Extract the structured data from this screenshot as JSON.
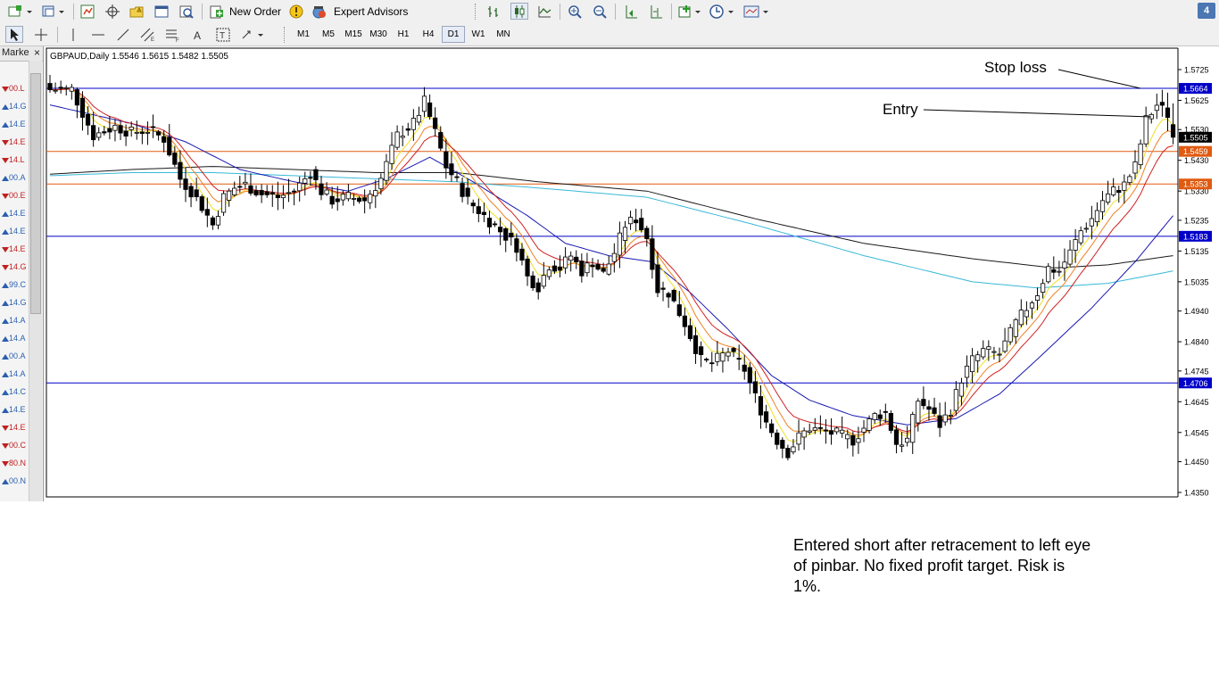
{
  "toolbar": {
    "new_order_label": "New Order",
    "expert_advisors_label": "Expert Advisors",
    "badge": "4"
  },
  "timeframes": [
    {
      "label": "M1",
      "active": false
    },
    {
      "label": "M5",
      "active": false
    },
    {
      "label": "M15",
      "active": false
    },
    {
      "label": "M30",
      "active": false
    },
    {
      "label": "H1",
      "active": false
    },
    {
      "label": "H4",
      "active": false
    },
    {
      "label": "D1",
      "active": true
    },
    {
      "label": "W1",
      "active": false
    },
    {
      "label": "MN",
      "active": false
    }
  ],
  "market_watch": {
    "title": "Marke",
    "rows": [
      {
        "text": "00.L",
        "color": "#c02020"
      },
      {
        "text": "14.G",
        "color": "#2a5fb0"
      },
      {
        "text": "14.E",
        "color": "#2a5fb0"
      },
      {
        "text": "14.E",
        "color": "#c02020"
      },
      {
        "text": "14.L",
        "color": "#c02020"
      },
      {
        "text": "00.A",
        "color": "#2a5fb0"
      },
      {
        "text": "00.E",
        "color": "#c02020"
      },
      {
        "text": "14.E",
        "color": "#2a5fb0"
      },
      {
        "text": "14.E",
        "color": "#2a5fb0"
      },
      {
        "text": "14.E",
        "color": "#c02020"
      },
      {
        "text": "14.G",
        "color": "#c02020"
      },
      {
        "text": "99.C",
        "color": "#2a5fb0"
      },
      {
        "text": "14.G",
        "color": "#2a5fb0"
      },
      {
        "text": "14.A",
        "color": "#2a5fb0"
      },
      {
        "text": "14.A",
        "color": "#2a5fb0"
      },
      {
        "text": "00.A",
        "color": "#2a5fb0"
      },
      {
        "text": "14.A",
        "color": "#2a5fb0"
      },
      {
        "text": "14.C",
        "color": "#2a5fb0"
      },
      {
        "text": "14.E",
        "color": "#2a5fb0"
      },
      {
        "text": "14.E",
        "color": "#c02020"
      },
      {
        "text": "00.C",
        "color": "#c02020"
      },
      {
        "text": "80.N",
        "color": "#c02020"
      },
      {
        "text": "00.N",
        "color": "#2a5fb0"
      }
    ]
  },
  "chart_data": {
    "type": "candlestick",
    "symbol_header": "GBPAUD,Daily  1.5546 1.5615 1.5482 1.5505",
    "ylim": [
      1.434,
      1.578
    ],
    "y_ticks": [
      1.5725,
      1.5625,
      1.553,
      1.543,
      1.533,
      1.5235,
      1.5135,
      1.5035,
      1.494,
      1.484,
      1.4745,
      1.4645,
      1.4545,
      1.445,
      1.435
    ],
    "y_tick_labels": [
      "1.5725",
      "1.5625",
      "1.5530",
      "1.5430",
      "1.5330",
      "1.5235",
      "1.5135",
      "1.5035",
      "1.4940",
      "1.4840",
      "1.4745",
      "1.4645",
      "1.4545",
      "1.4450",
      "1.4350"
    ],
    "horizontal_lines": [
      {
        "value": 1.5664,
        "label": "1.5664",
        "color": "#0000c8"
      },
      {
        "value": 1.5459,
        "label": "1.5459",
        "color": "#e05a10"
      },
      {
        "value": 1.5353,
        "label": "1.5353",
        "color": "#e05a10"
      },
      {
        "value": 1.5183,
        "label": "1.5183",
        "color": "#0000c8"
      },
      {
        "value": 1.4706,
        "label": "1.4706",
        "color": "#0000c8"
      }
    ],
    "current_price": {
      "value": 1.5505,
      "label": "1.5505"
    },
    "anchors": [
      [
        0,
        1.566
      ],
      [
        4,
        1.566
      ],
      [
        8,
        1.551
      ],
      [
        12,
        1.554
      ],
      [
        15,
        1.552
      ],
      [
        18,
        1.553
      ],
      [
        21,
        1.55
      ],
      [
        24,
        1.537
      ],
      [
        26,
        1.533
      ],
      [
        28,
        1.528
      ],
      [
        30,
        1.522
      ],
      [
        32,
        1.531
      ],
      [
        34,
        1.534
      ],
      [
        36,
        1.535
      ],
      [
        39,
        1.532
      ],
      [
        42,
        1.531
      ],
      [
        45,
        1.533
      ],
      [
        48,
        1.539
      ],
      [
        50,
        1.533
      ],
      [
        52,
        1.53
      ],
      [
        55,
        1.531
      ],
      [
        58,
        1.53
      ],
      [
        61,
        1.537
      ],
      [
        64,
        1.551
      ],
      [
        67,
        1.555
      ],
      [
        69,
        1.562
      ],
      [
        71,
        1.552
      ],
      [
        73,
        1.541
      ],
      [
        75,
        1.536
      ],
      [
        77,
        1.53
      ],
      [
        80,
        1.525
      ],
      [
        83,
        1.52
      ],
      [
        86,
        1.515
      ],
      [
        88,
        1.505
      ],
      [
        90,
        1.502
      ],
      [
        92,
        1.509
      ],
      [
        94,
        1.508
      ],
      [
        96,
        1.512
      ],
      [
        98,
        1.507
      ],
      [
        100,
        1.51
      ],
      [
        102,
        1.506
      ],
      [
        104,
        1.513
      ],
      [
        106,
        1.522
      ],
      [
        108,
        1.524
      ],
      [
        110,
        1.518
      ],
      [
        112,
        1.501
      ],
      [
        114,
        1.5
      ],
      [
        117,
        1.49
      ],
      [
        120,
        1.478
      ],
      [
        122,
        1.477
      ],
      [
        125,
        1.481
      ],
      [
        128,
        1.475
      ],
      [
        130,
        1.466
      ],
      [
        132,
        1.458
      ],
      [
        134,
        1.452
      ],
      [
        136,
        1.448
      ],
      [
        138,
        1.453
      ],
      [
        140,
        1.456
      ],
      [
        142,
        1.455
      ],
      [
        145,
        1.454
      ],
      [
        148,
        1.452
      ],
      [
        150,
        1.456
      ],
      [
        152,
        1.46
      ],
      [
        154,
        1.461
      ],
      [
        156,
        1.451
      ],
      [
        158,
        1.452
      ],
      [
        160,
        1.465
      ],
      [
        162,
        1.462
      ],
      [
        164,
        1.457
      ],
      [
        166,
        1.462
      ],
      [
        168,
        1.472
      ],
      [
        170,
        1.478
      ],
      [
        172,
        1.481
      ],
      [
        175,
        1.48
      ],
      [
        178,
        1.49
      ],
      [
        180,
        1.495
      ],
      [
        182,
        1.5
      ],
      [
        184,
        1.508
      ],
      [
        186,
        1.507
      ],
      [
        188,
        1.513
      ],
      [
        190,
        1.52
      ],
      [
        192,
        1.524
      ],
      [
        194,
        1.53
      ],
      [
        196,
        1.533
      ],
      [
        198,
        1.535
      ],
      [
        200,
        1.541
      ],
      [
        202,
        1.556
      ],
      [
        204,
        1.561
      ],
      [
        206,
        1.558
      ],
      [
        207,
        1.5505
      ]
    ],
    "ma_anchor_sets": {
      "ma_blue": [
        [
          0,
          1.561
        ],
        [
          15,
          1.555
        ],
        [
          25,
          1.549
        ],
        [
          35,
          1.54
        ],
        [
          45,
          1.536
        ],
        [
          55,
          1.533
        ],
        [
          62,
          1.537
        ],
        [
          70,
          1.544
        ],
        [
          78,
          1.536
        ],
        [
          88,
          1.525
        ],
        [
          95,
          1.516
        ],
        [
          103,
          1.512
        ],
        [
          111,
          1.51
        ],
        [
          118,
          1.5
        ],
        [
          125,
          1.488
        ],
        [
          133,
          1.473
        ],
        [
          140,
          1.465
        ],
        [
          148,
          1.46
        ],
        [
          158,
          1.457
        ],
        [
          167,
          1.459
        ],
        [
          175,
          1.467
        ],
        [
          183,
          1.48
        ],
        [
          192,
          1.495
        ],
        [
          200,
          1.51
        ],
        [
          207,
          1.525
        ]
      ],
      "ma_black": [
        [
          0,
          1.5385
        ],
        [
          15,
          1.54
        ],
        [
          30,
          1.541
        ],
        [
          45,
          1.54
        ],
        [
          60,
          1.539
        ],
        [
          75,
          1.539
        ],
        [
          90,
          1.536
        ],
        [
          110,
          1.533
        ],
        [
          130,
          1.524
        ],
        [
          150,
          1.516
        ],
        [
          170,
          1.511
        ],
        [
          185,
          1.508
        ],
        [
          195,
          1.509
        ],
        [
          207,
          1.512
        ]
      ],
      "ma_cyan": [
        [
          0,
          1.538
        ],
        [
          15,
          1.539
        ],
        [
          30,
          1.539
        ],
        [
          45,
          1.538
        ],
        [
          60,
          1.537
        ],
        [
          75,
          1.536
        ],
        [
          90,
          1.534
        ],
        [
          110,
          1.531
        ],
        [
          130,
          1.522
        ],
        [
          150,
          1.512
        ],
        [
          170,
          1.5035
        ],
        [
          182,
          1.5015
        ],
        [
          195,
          1.503
        ],
        [
          207,
          1.507
        ]
      ]
    },
    "annotations": [
      {
        "text": "Stop loss",
        "from": [
          1103,
          76
        ],
        "to": [
          1278,
          99
        ]
      },
      {
        "text": "Entry",
        "from": [
          1035,
          123
        ],
        "to": [
          1290,
          131
        ]
      }
    ]
  },
  "note": "Entered short after retracement to left eye\nof pinbar. No fixed profit target. Risk is\n1%."
}
